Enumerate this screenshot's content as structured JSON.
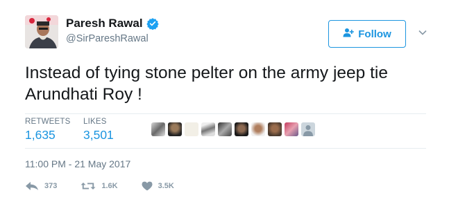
{
  "user": {
    "name": "Paresh Rawal",
    "handle": "@SirPareshRawal",
    "avatar_icon": "profile-photo",
    "verified_icon": "verified-badge-icon"
  },
  "follow_button": {
    "label": "Follow",
    "icon": "person-plus-icon"
  },
  "menu": {
    "icon": "chevron-down-icon"
  },
  "tweet": {
    "text": "Instead of tying stone pelter on the army jeep tie Arundhati Roy !"
  },
  "stats": {
    "retweets_label": "RETWEETS",
    "retweets_value": "1,635",
    "likes_label": "LIKES",
    "likes_value": "3,501"
  },
  "likers": [
    {
      "icon": "liker-avatar"
    },
    {
      "icon": "liker-avatar"
    },
    {
      "icon": "liker-avatar"
    },
    {
      "icon": "liker-avatar"
    },
    {
      "icon": "liker-avatar"
    },
    {
      "icon": "liker-avatar"
    },
    {
      "icon": "liker-avatar"
    },
    {
      "icon": "liker-avatar"
    },
    {
      "icon": "liker-avatar"
    },
    {
      "icon": "default-avatar"
    }
  ],
  "timestamp": "11:00 PM - 21 May 2017",
  "actions": {
    "reply_count": "373",
    "retweet_count": "1.6K",
    "like_count": "3.5K"
  },
  "colors": {
    "accent": "#1b95e0",
    "muted": "#657786",
    "icon_gray": "#8899a6",
    "divider": "#e6ecf0",
    "text": "#14171a"
  }
}
